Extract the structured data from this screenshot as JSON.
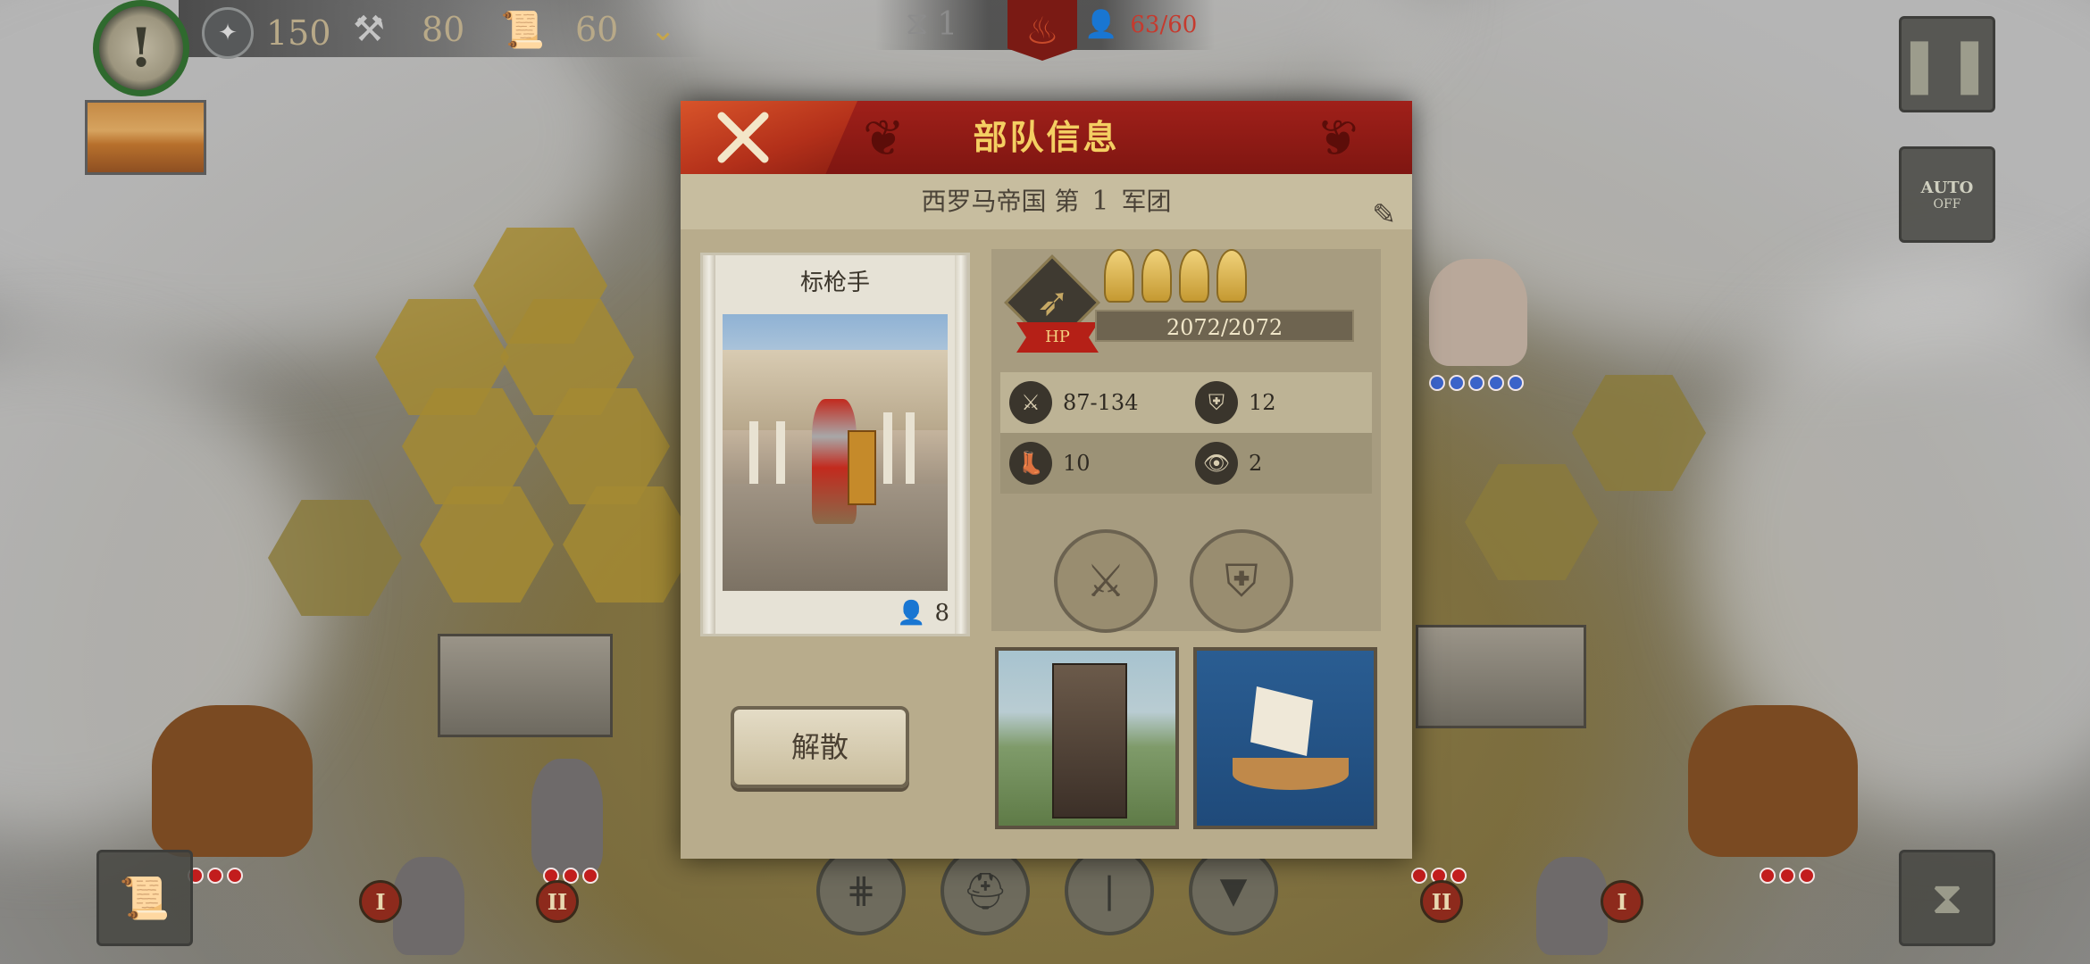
{
  "hud": {
    "resource_1": "150",
    "resource_2": "80",
    "resource_3": "60",
    "turn_count": "1",
    "population": "63/60",
    "auto_label_1": "AUTO",
    "auto_label_2": "OFF"
  },
  "modal": {
    "title": "部队信息",
    "legion_prefix": "西罗马帝国 第",
    "legion_number": "1",
    "legion_suffix": "军团",
    "unit_name": "标枪手",
    "unit_count": "8",
    "hp_label": "HP",
    "hp_value": "2072/2072",
    "helmet_count": 4,
    "stats": {
      "attack": "87-134",
      "defense": "12",
      "move": "10",
      "vision": "2"
    },
    "dissolve_label": "解散"
  },
  "map_badges": {
    "left_roman_1": "I",
    "left_roman_2": "II",
    "right_roman_1": "II",
    "right_roman_2": "I"
  },
  "colors": {
    "modal_red": "#8f1b14",
    "title_gold": "#f4cf62",
    "pop_red": "#c63a2e",
    "parchment": "#b8ac8c"
  }
}
